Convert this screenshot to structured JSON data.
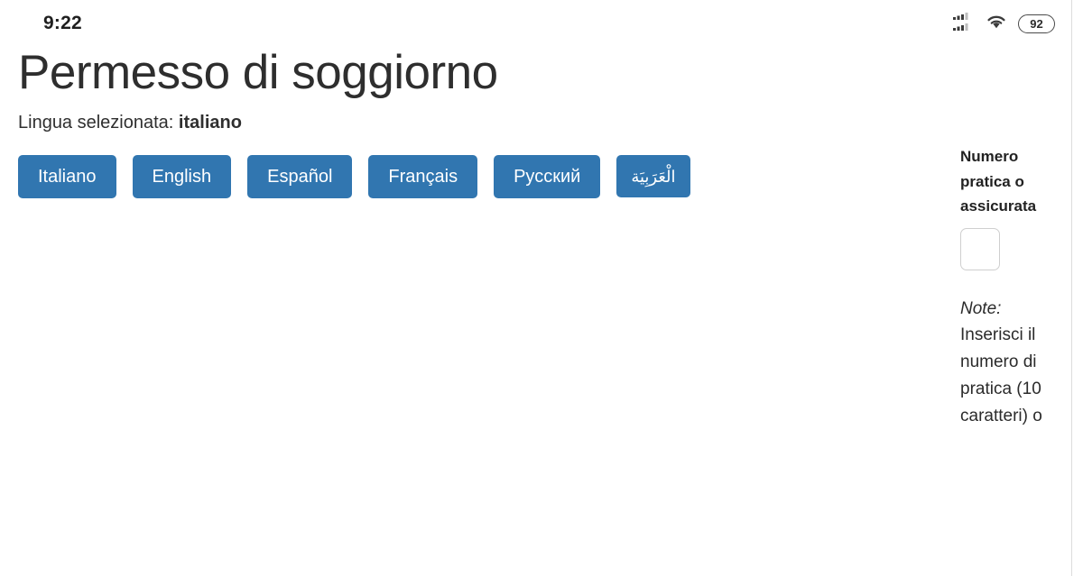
{
  "status_bar": {
    "clock": "9:22",
    "signal_icon": "dual-sim-signal-bars-icon",
    "wifi_icon": "wifi-icon",
    "battery_icon": "battery-icon",
    "battery_level": "92"
  },
  "page": {
    "title": "Permesso di soggiorno",
    "selected_language_prefix": "Lingua selezionata: ",
    "selected_language_value": "italiano"
  },
  "language_buttons": [
    {
      "label": "Italiano",
      "name": "lang-button-italiano",
      "rtl": false
    },
    {
      "label": "English",
      "name": "lang-button-english",
      "rtl": false
    },
    {
      "label": "Español",
      "name": "lang-button-espanol",
      "rtl": false
    },
    {
      "label": "Français",
      "name": "lang-button-francais",
      "rtl": false
    },
    {
      "label": "Русский",
      "name": "lang-button-russkiy",
      "rtl": false
    },
    {
      "label": "الْعَرَبِيَة",
      "name": "lang-button-arabic",
      "rtl": true
    }
  ],
  "sidebar": {
    "field_label": "Numero pratica o assicurata",
    "field_value": "",
    "note_prefix": "Note:",
    "note_text": "Inserisci il numero di pratica (10 caratteri) o"
  },
  "colors": {
    "button_blue": "#3176b0",
    "text_dark": "#2e2e2e",
    "divider": "#dcdcdc",
    "input_border": "#cfcfcf"
  }
}
